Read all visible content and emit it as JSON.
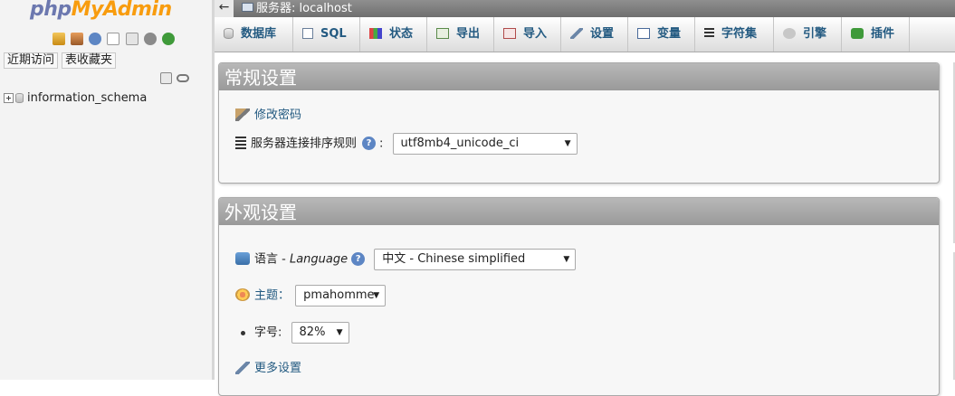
{
  "nav": {
    "logo_php": "php",
    "logo_myadmin": "MyAdmin",
    "icons": [
      "home-icon",
      "exit-icon",
      "help-icon",
      "docs-icon",
      "sql-docs-icon",
      "settings-icon",
      "reload-icon"
    ],
    "tabs": [
      "近期访问",
      "表收藏夹"
    ],
    "databases": [
      {
        "name": "information_schema"
      }
    ]
  },
  "breadcrumb": {
    "back": "←",
    "server": "服务器: localhost"
  },
  "menu": [
    {
      "label": "数据库",
      "icon": "database-icon"
    },
    {
      "label": "SQL",
      "icon": "sql-icon"
    },
    {
      "label": "状态",
      "icon": "status-icon"
    },
    {
      "label": "导出",
      "icon": "export-icon"
    },
    {
      "label": "导入",
      "icon": "import-icon"
    },
    {
      "label": "设置",
      "icon": "wrench-icon"
    },
    {
      "label": "变量",
      "icon": "variables-icon"
    },
    {
      "label": "字符集",
      "icon": "charset-icon"
    },
    {
      "label": "引擎",
      "icon": "engine-icon"
    },
    {
      "label": "插件",
      "icon": "plugin-icon"
    }
  ],
  "general": {
    "title": "常规设置",
    "change_password": "修改密码",
    "collation_label": "服务器连接排序规则",
    "collation_colon": ":",
    "collation_value": "utf8mb4_unicode_ci"
  },
  "appearance": {
    "title": "外观设置",
    "language_label": "语言 - ",
    "language_italic": "Language",
    "language_value": "中文 - Chinese simplified",
    "theme_label": "主题：",
    "theme_value": "pmahomme",
    "fontsize_label": "字号:",
    "fontsize_value": "82%",
    "more_settings": "更多设置"
  },
  "colors": {
    "link": "#235a81",
    "logo_php": "#6c78af",
    "logo_myadmin": "#f89c0e",
    "panel_header": "#9a9a9a"
  }
}
